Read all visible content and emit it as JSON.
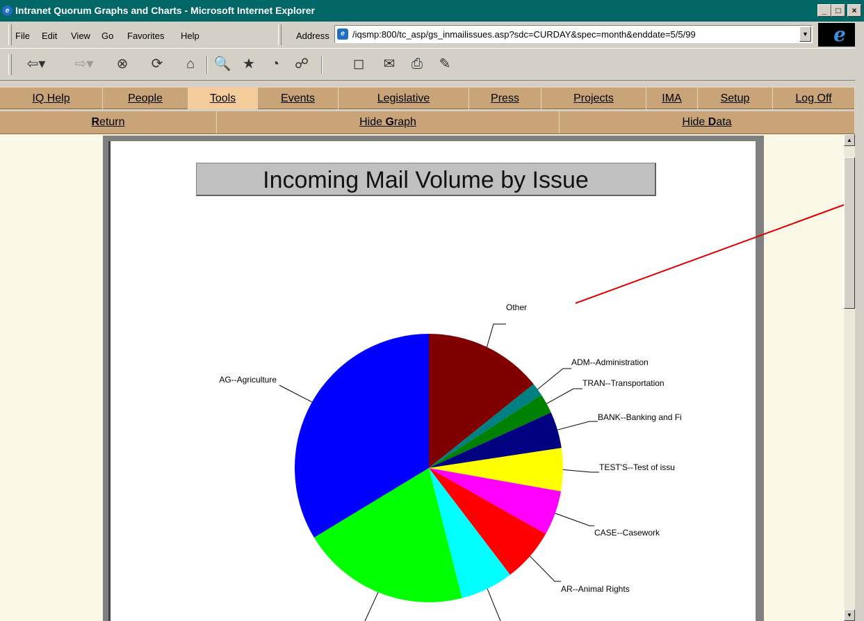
{
  "window": {
    "title": "Intranet Quorum Graphs and Charts - Microsoft Internet Explorer",
    "buttons": [
      "_",
      "□",
      "×"
    ]
  },
  "menubar": {
    "items": [
      {
        "label": "File"
      },
      {
        "label": "Edit"
      },
      {
        "label": "View"
      },
      {
        "label": "Go"
      },
      {
        "label": "Favorites"
      },
      {
        "label": "Help"
      }
    ],
    "address_label": "Address",
    "address_url": "/iqsmp:800/tc_asp/gs_inmailissues.asp?sdc=CURDAY&spec=month&enddate=5/5/99"
  },
  "toolbar": {
    "icons": [
      "back-icon",
      "forward-icon",
      "stop-icon",
      "refresh-icon",
      "home-icon",
      "search-icon",
      "favorites-icon",
      "history-icon",
      "channels-icon",
      "fullscreen-icon",
      "mail-icon",
      "print-icon",
      "edit-icon"
    ]
  },
  "nav": {
    "tabs": [
      {
        "label": "IQ Help"
      },
      {
        "label": "People"
      },
      {
        "label": "Tools"
      },
      {
        "label": "Events"
      },
      {
        "label": "Legislative"
      },
      {
        "label": "Press"
      },
      {
        "label": "Projects"
      },
      {
        "label": "IMA"
      },
      {
        "label": "Setup"
      },
      {
        "label": "Log Off"
      }
    ],
    "active_tab": "Tools",
    "colors": {
      "bar": "#c8a478",
      "active": "#f4cc9c"
    }
  },
  "subnav": {
    "items": [
      {
        "pre": "",
        "bold": "R",
        "post": "eturn"
      },
      {
        "pre": "Hide ",
        "bold": "G",
        "post": "raph"
      },
      {
        "pre": "Hide ",
        "bold": "D",
        "post": "ata"
      }
    ]
  },
  "chart_data": {
    "type": "pie",
    "title": "Incoming Mail Volume by Issue",
    "slices": [
      {
        "label": "Other",
        "value": 14.3,
        "color": "#800000"
      },
      {
        "label": "ADM--Administration",
        "value": 1.6,
        "color": "#008080"
      },
      {
        "label": "TRAN--Transportation",
        "value": 2.4,
        "color": "#008000"
      },
      {
        "label": "BANK--Banking and Fi",
        "value": 4.4,
        "color": "#000080"
      },
      {
        "label": "TEST'S--Test of issu",
        "value": 5.2,
        "color": "#ffff00"
      },
      {
        "label": "CASE--Casework",
        "value": 5.4,
        "color": "#ff00ff"
      },
      {
        "label": "AR--Animal Rights",
        "value": 6.5,
        "color": "#ff0000"
      },
      {
        "label": "",
        "value": 6.4,
        "color": "#00ffff"
      },
      {
        "label": "",
        "value": 20.4,
        "color": "#00ff00"
      },
      {
        "label": "AG--Agriculture",
        "value": 33.8,
        "color": "#0000ff"
      }
    ]
  },
  "annotation": {
    "color": "#dd0000"
  }
}
